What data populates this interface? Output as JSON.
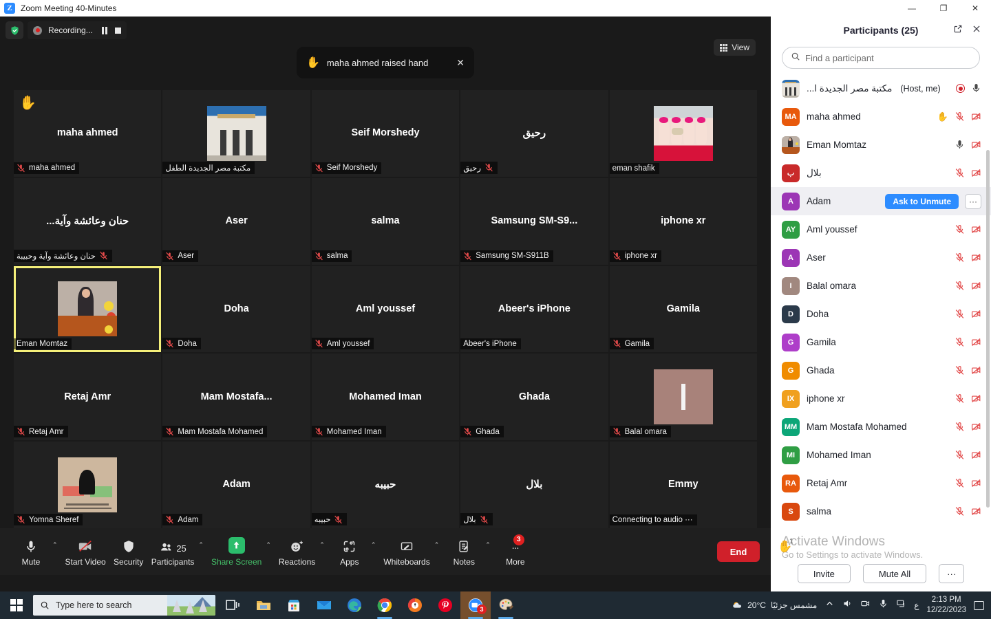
{
  "window": {
    "title": "Zoom Meeting 40-Minutes",
    "logo_text": "Z",
    "minimize": "—",
    "maximize": "❐",
    "close": "✕"
  },
  "stage": {
    "recording": {
      "label": "Recording...",
      "pause_icon": "pause-icon",
      "stop_icon": "stop-icon",
      "shield_icon": "shield-check-icon"
    },
    "view_button": {
      "label": "View",
      "icon": "grid-view-icon"
    },
    "toast": {
      "hand": "✋",
      "text": "maha ahmed raised hand",
      "close": "✕"
    }
  },
  "tiles": [
    {
      "display": "maha ahmed",
      "label": "maha ahmed",
      "muted": true,
      "rtl": false,
      "hand": true,
      "thumb": null
    },
    {
      "display": "",
      "label": "مكتبة مصر الجديدة الطفل",
      "muted": false,
      "rtl": true,
      "hand": false,
      "thumb": "library"
    },
    {
      "display": "Seif Morshedy",
      "label": "Seif Morshedy",
      "muted": true,
      "rtl": false,
      "hand": false,
      "thumb": null
    },
    {
      "display": "رحيق",
      "label": "رحيق",
      "muted": true,
      "rtl": true,
      "hand": false,
      "thumb": null
    },
    {
      "display": "",
      "label": "eman shafik",
      "muted": false,
      "rtl": false,
      "hand": false,
      "thumb": "nails"
    },
    {
      "display": "حنان وعائشة وآية...",
      "label": "حنان وعائشة وآية وحبيبة",
      "muted": true,
      "rtl": true,
      "hand": false,
      "thumb": null
    },
    {
      "display": "Aser",
      "label": "Aser",
      "muted": true,
      "rtl": false,
      "hand": false,
      "thumb": null
    },
    {
      "display": "salma",
      "label": "salma",
      "muted": true,
      "rtl": false,
      "hand": false,
      "thumb": null
    },
    {
      "display": "Samsung  SM-S9...",
      "label": "Samsung SM-S911B",
      "muted": true,
      "rtl": false,
      "hand": false,
      "thumb": null
    },
    {
      "display": "iphone xr",
      "label": "iphone xr",
      "muted": true,
      "rtl": false,
      "hand": false,
      "thumb": null
    },
    {
      "display": "",
      "label": "Eman Momtaz",
      "muted": false,
      "rtl": false,
      "hand": false,
      "thumb": "podium",
      "active": true
    },
    {
      "display": "Doha",
      "label": "Doha",
      "muted": true,
      "rtl": false,
      "hand": false,
      "thumb": null
    },
    {
      "display": "Aml youssef",
      "label": "Aml youssef",
      "muted": true,
      "rtl": false,
      "hand": false,
      "thumb": null
    },
    {
      "display": "Abeer's iPhone",
      "label": "Abeer's iPhone",
      "muted": false,
      "rtl": false,
      "hand": false,
      "thumb": null
    },
    {
      "display": "Gamila",
      "label": "Gamila",
      "muted": true,
      "rtl": false,
      "hand": false,
      "thumb": null
    },
    {
      "display": "Retaj Amr",
      "label": "Retaj Amr",
      "muted": true,
      "rtl": false,
      "hand": false,
      "thumb": null
    },
    {
      "display": "Mam  Mostafa...",
      "label": "Mam Mostafa Mohamed",
      "muted": true,
      "rtl": false,
      "hand": false,
      "thumb": null
    },
    {
      "display": "Mohamed Iman",
      "label": "Mohamed Iman",
      "muted": true,
      "rtl": false,
      "hand": false,
      "thumb": null
    },
    {
      "display": "Ghada",
      "label": "Ghada",
      "muted": true,
      "rtl": false,
      "hand": false,
      "thumb": null
    },
    {
      "display": "",
      "label": "Balal omara",
      "muted": true,
      "rtl": false,
      "hand": false,
      "thumb": "solid"
    },
    {
      "display": "",
      "label": "Yomna Sheref",
      "muted": true,
      "rtl": false,
      "hand": false,
      "thumb": "palestine"
    },
    {
      "display": "Adam",
      "label": "Adam",
      "muted": true,
      "rtl": false,
      "hand": false,
      "thumb": null
    },
    {
      "display": "حبيبه",
      "label": "حبيبه",
      "muted": true,
      "rtl": true,
      "hand": false,
      "thumb": null
    },
    {
      "display": "بلال",
      "label": "بلال",
      "muted": true,
      "rtl": true,
      "hand": false,
      "thumb": null
    },
    {
      "display": "Emmy",
      "label": "Connecting to audio ···",
      "muted": false,
      "rtl": false,
      "hand": false,
      "thumb": null
    }
  ],
  "toolbar": {
    "items": [
      {
        "label": "Mute",
        "icon": "microphone-icon",
        "caret": true
      },
      {
        "label": "Start Video",
        "icon": "video-off-icon",
        "caret": false
      },
      {
        "label": "Security",
        "icon": "shield-icon",
        "caret": false
      },
      {
        "label": "Participants",
        "icon": "participants-icon",
        "caret": true,
        "count": "25"
      },
      {
        "label": "Share Screen",
        "icon": "share-screen-icon",
        "caret": true
      },
      {
        "label": "Reactions",
        "icon": "reactions-icon",
        "caret": true
      },
      {
        "label": "Apps",
        "icon": "apps-icon",
        "caret": true
      },
      {
        "label": "Whiteboards",
        "icon": "whiteboard-icon",
        "caret": true
      },
      {
        "label": "Notes",
        "icon": "notes-icon",
        "caret": true
      },
      {
        "label": "More",
        "icon": "more-icon",
        "caret": false,
        "badge": "3"
      }
    ],
    "end_label": "End"
  },
  "panel": {
    "title": "Participants (25)",
    "popout_icon": "popout-icon",
    "close_icon": "close-icon",
    "search_placeholder": "Find a participant",
    "search_value": "",
    "search_icon": "search-icon",
    "participants": [
      {
        "name": "مكتبة مصر الجديدة ا...",
        "suffix": "(Host, me)",
        "rtl": true,
        "avatar_type": "image-library",
        "initials": "",
        "color": "#d7e1ec",
        "mic": "on",
        "video": "none",
        "recording": true
      },
      {
        "name": "maha ahmed",
        "suffix": "",
        "rtl": false,
        "avatar_type": "initials",
        "initials": "MA",
        "color": "#e8590c",
        "mic": "off",
        "video": "off",
        "hand": true
      },
      {
        "name": "Eman Momtaz",
        "suffix": "",
        "rtl": false,
        "avatar_type": "image-podium",
        "initials": "",
        "color": "#b5561d",
        "mic": "on",
        "video": "off"
      },
      {
        "name": "بلال",
        "suffix": "",
        "rtl": true,
        "avatar_type": "initials",
        "initials": "ب",
        "color": "#c92a2a",
        "mic": "off",
        "video": "off"
      },
      {
        "name": "Adam",
        "suffix": "",
        "rtl": false,
        "avatar_type": "initials",
        "initials": "A",
        "color": "#9c36b5",
        "mic": "off",
        "video": "off",
        "selected": true,
        "action": "Ask to Unmute",
        "more": "···"
      },
      {
        "name": "Aml youssef",
        "suffix": "",
        "rtl": false,
        "avatar_type": "initials",
        "initials": "AY",
        "color": "#2f9e44",
        "mic": "off",
        "video": "off"
      },
      {
        "name": "Aser",
        "suffix": "",
        "rtl": false,
        "avatar_type": "initials",
        "initials": "A",
        "color": "#9c36b5",
        "mic": "off",
        "video": "off"
      },
      {
        "name": "Balal omara",
        "suffix": "",
        "rtl": false,
        "avatar_type": "initials",
        "initials": "I",
        "color": "#a1887f",
        "mic": "off",
        "video": "off"
      },
      {
        "name": "Doha",
        "suffix": "",
        "rtl": false,
        "avatar_type": "initials",
        "initials": "D",
        "color": "#2b3a4a",
        "mic": "off",
        "video": "off"
      },
      {
        "name": "Gamila",
        "suffix": "",
        "rtl": false,
        "avatar_type": "initials",
        "initials": "G",
        "color": "#ae3ec9",
        "mic": "off",
        "video": "off"
      },
      {
        "name": "Ghada",
        "suffix": "",
        "rtl": false,
        "avatar_type": "initials",
        "initials": "G",
        "color": "#f08c00",
        "mic": "off",
        "video": "off"
      },
      {
        "name": "iphone xr",
        "suffix": "",
        "rtl": false,
        "avatar_type": "initials",
        "initials": "IX",
        "color": "#f0a01e",
        "mic": "off",
        "video": "off"
      },
      {
        "name": "Mam Mostafa Mohamed",
        "suffix": "",
        "rtl": false,
        "avatar_type": "initials",
        "initials": "MM",
        "color": "#0ca678",
        "mic": "off",
        "video": "off"
      },
      {
        "name": "Mohamed Iman",
        "suffix": "",
        "rtl": false,
        "avatar_type": "initials",
        "initials": "MI",
        "color": "#2f9e44",
        "mic": "off",
        "video": "off"
      },
      {
        "name": "Retaj Amr",
        "suffix": "",
        "rtl": false,
        "avatar_type": "initials",
        "initials": "RA",
        "color": "#e8590c",
        "mic": "off",
        "video": "off"
      },
      {
        "name": "salma",
        "suffix": "",
        "rtl": false,
        "avatar_type": "initials",
        "initials": "S",
        "color": "#d9480f",
        "mic": "off",
        "video": "off"
      }
    ],
    "watermark": {
      "line1": "Activate Windows",
      "line2": "Go to Settings to activate Windows.",
      "hand_count": "1"
    },
    "footer": {
      "invite": "Invite",
      "mute_all": "Mute All",
      "more": "···"
    }
  },
  "taskbar": {
    "start_icon": "windows-start-icon",
    "search_placeholder": "Type here to search",
    "apps": [
      {
        "name": "task-view-icon"
      },
      {
        "name": "file-explorer-icon"
      },
      {
        "name": "microsoft-store-icon"
      },
      {
        "name": "mail-icon"
      },
      {
        "name": "edge-icon"
      },
      {
        "name": "chrome-icon"
      },
      {
        "name": "avast-icon"
      },
      {
        "name": "pinterest-icon"
      },
      {
        "name": "zoom-icon",
        "badge": "3",
        "active": true
      },
      {
        "name": "paint-icon"
      }
    ],
    "weather": {
      "temp": "20°C",
      "desc": "مشمس جزئيًا"
    },
    "lang": "ع",
    "time": "2:13 PM",
    "date": "12/22/2023"
  }
}
